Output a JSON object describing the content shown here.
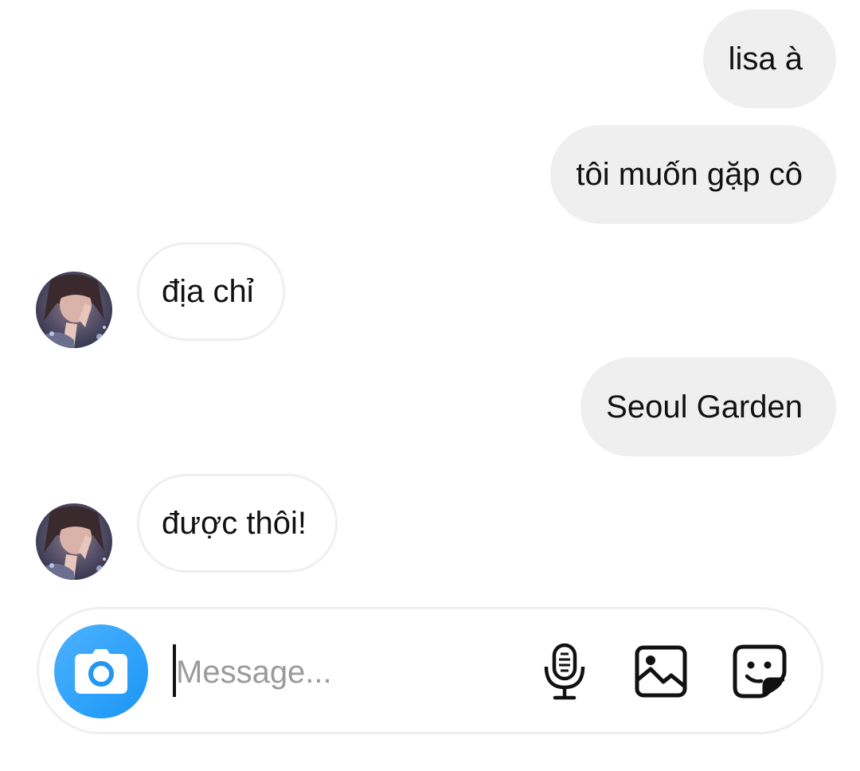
{
  "messages": [
    {
      "direction": "outgoing",
      "text": "lisa à"
    },
    {
      "direction": "outgoing",
      "text": "tôi muốn gặp cô"
    },
    {
      "direction": "incoming",
      "text": "địa chỉ"
    },
    {
      "direction": "outgoing",
      "text": "Seoul Garden"
    },
    {
      "direction": "incoming",
      "text": "được thôi!"
    }
  ],
  "composer": {
    "placeholder": "Message...",
    "value": "",
    "camera_icon": "camera-icon",
    "microphone_icon": "microphone-icon",
    "gallery_icon": "image-icon",
    "sticker_icon": "sticker-icon"
  },
  "colors": {
    "accent": "#2ba2ff",
    "outgoing_bubble": "#efefef",
    "incoming_border": "#efefef",
    "placeholder": "#9a9a9a"
  }
}
